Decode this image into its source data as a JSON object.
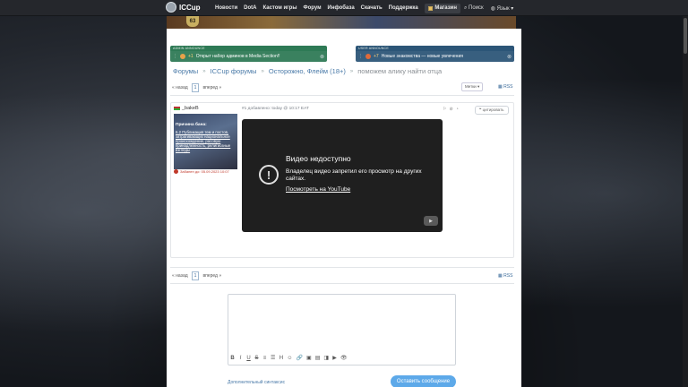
{
  "topnav": {
    "logo": "ICCup",
    "items": [
      "Новости",
      "DotA",
      "Кастом игры",
      "Форум",
      "Инфобаза",
      "Скачать",
      "Поддержка"
    ],
    "shop": "Магазин",
    "search": "Поиск",
    "lang": "Язык"
  },
  "banner": {
    "level": "63"
  },
  "announcements": {
    "admin": {
      "head": "ADMIN ANNOUNCE",
      "count": "+1",
      "text": "Открыт набор админов в Media Section!!"
    },
    "user": {
      "head": "USER ANNOUNCE",
      "count": "+7",
      "text": "Новые знакомства — новые увлечения"
    }
  },
  "breadcrumbs": {
    "items": [
      "Форумы",
      "ICCup форумы",
      "Осторожно, Флейм (18+)"
    ],
    "current": "поможем алику найти отца"
  },
  "pager": {
    "prev": "« назад",
    "page": "1",
    "next": "вперед »",
    "rss": "RSS"
  },
  "watch": "Метки",
  "post": {
    "username": "_bakeB",
    "card_title": "Причина бана:",
    "card_reason": "6.2 Публикация тем и постов, затрагивающих национальное происхождение, расовую принадлежность, религиозные взгляды",
    "ban": "Забанен до: 05.09.2023 10:07",
    "meta": "#1 добавлено: today @ 10:17 EAT",
    "quote": "цитировать"
  },
  "video": {
    "title": "Видео недоступно",
    "desc": "Владелец видео запретил его просмотр на других сайтах.",
    "link": "Посмотреть на YouTube"
  },
  "editor": {
    "tools": [
      "B",
      "I",
      "U",
      "S",
      "≡",
      "☰",
      "H",
      "☺",
      "🔗",
      "▣",
      "▤",
      "◨",
      "▶",
      "👁"
    ],
    "syntax": "Дополнительный синтаксис",
    "submit": "Оставить сообщение"
  }
}
